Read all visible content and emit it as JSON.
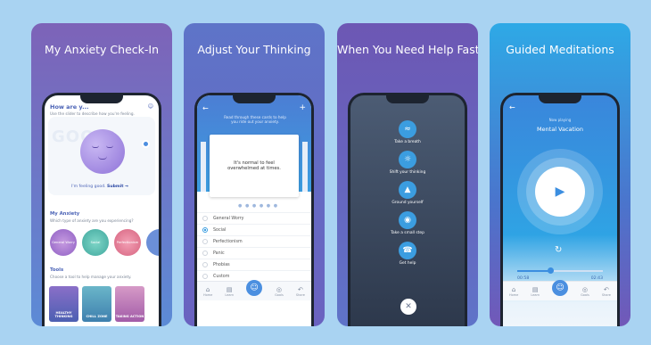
{
  "panels": [
    {
      "title": "My Anxiety Check-In"
    },
    {
      "title": "Adjust Your Thinking"
    },
    {
      "title": "When You Need Help Fast"
    },
    {
      "title": "Guided Meditations"
    }
  ],
  "checkin": {
    "header": "How are y...",
    "subtitle": "Use the slider to describe how you're feeling.",
    "mood_word": "GOOD",
    "feeling_text": "I'm feeling good.",
    "submit_label": "Submit →",
    "my_anxiety_title": "My Anxiety",
    "my_anxiety_sub": "Which type of anxiety are you experiencing?",
    "types": [
      "General Worry",
      "Social",
      "Perfectionism"
    ],
    "tools_title": "Tools",
    "tools_sub": "Choose a tool to help manage your anxiety.",
    "tools": [
      "HEALTHY THINKING",
      "CHILL ZONE",
      "TAKING ACTION"
    ]
  },
  "thinking": {
    "hint": "Read through these cards to help you ride out your anxiety.",
    "card_text": "It's normal to feel overwhelmed at times.",
    "options": [
      "General Worry",
      "Social",
      "Perfectionism",
      "Panic",
      "Phobias",
      "Custom"
    ],
    "selected_index": 1,
    "tabs": [
      "Home",
      "Learn",
      "",
      "Goals",
      "Share"
    ]
  },
  "help": {
    "items": [
      "Take a breath",
      "Shift your thinking",
      "Ground yourself",
      "Take a small step",
      "Get help"
    ]
  },
  "meditation": {
    "caption": "Now playing",
    "title": "Mental Vacation",
    "elapsed": "00:58",
    "total": "02:43",
    "progress": 0.36,
    "tabs": [
      "Home",
      "Learn",
      "",
      "Goals",
      "Share"
    ]
  }
}
